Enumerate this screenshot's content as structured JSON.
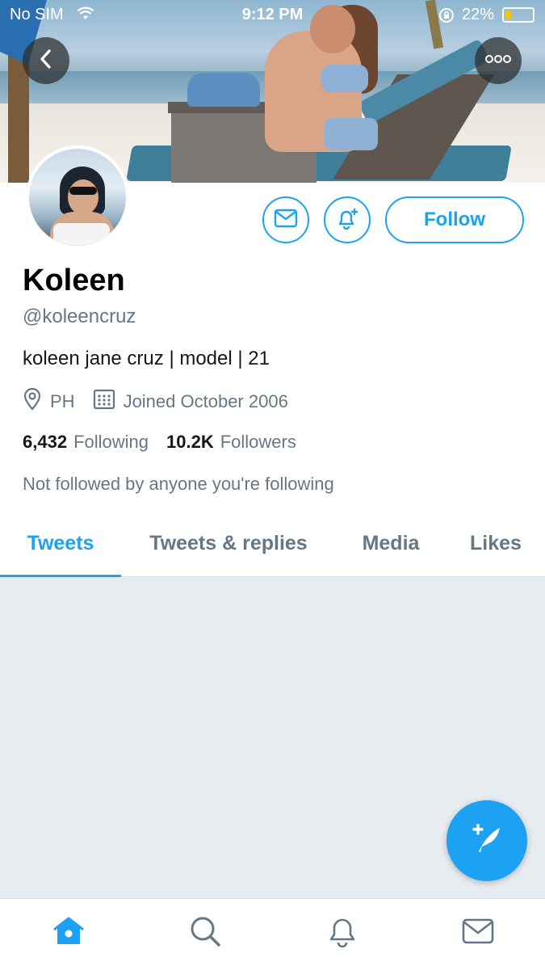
{
  "status_bar": {
    "carrier": "No SIM",
    "time": "9:12 PM",
    "battery": "22%",
    "battery_level": 0.22
  },
  "header": {
    "back_icon": "chevron-left-icon",
    "more_icon": "more-dots-icon"
  },
  "profile": {
    "display_name": "Koleen",
    "handle": "@koleencruz",
    "bio": "koleen jane cruz | model | 21",
    "location": "PH",
    "joined": "Joined October 2006",
    "following_count": "6,432",
    "following_label": "Following",
    "followers_count": "10.2K",
    "followers_label": "Followers",
    "social_context": "Not followed by anyone you're following"
  },
  "actions": {
    "follow_label": "Follow",
    "message_icon": "mail-icon",
    "notify_icon": "bell-plus-icon"
  },
  "tabs": [
    {
      "label": "Tweets",
      "active": true
    },
    {
      "label": "Tweets & replies",
      "active": false
    },
    {
      "label": "Media",
      "active": false
    },
    {
      "label": "Likes",
      "active": false
    }
  ],
  "compose": {
    "icon": "compose-feather-icon"
  },
  "bottom_nav": [
    {
      "icon": "home-icon",
      "active": true
    },
    {
      "icon": "search-icon",
      "active": false
    },
    {
      "icon": "bell-icon",
      "active": false
    },
    {
      "icon": "mail-icon",
      "active": false
    }
  ],
  "colors": {
    "accent": "#1da1f2",
    "secondary_text": "#657786",
    "timeline_bg": "#e6ecf0"
  }
}
